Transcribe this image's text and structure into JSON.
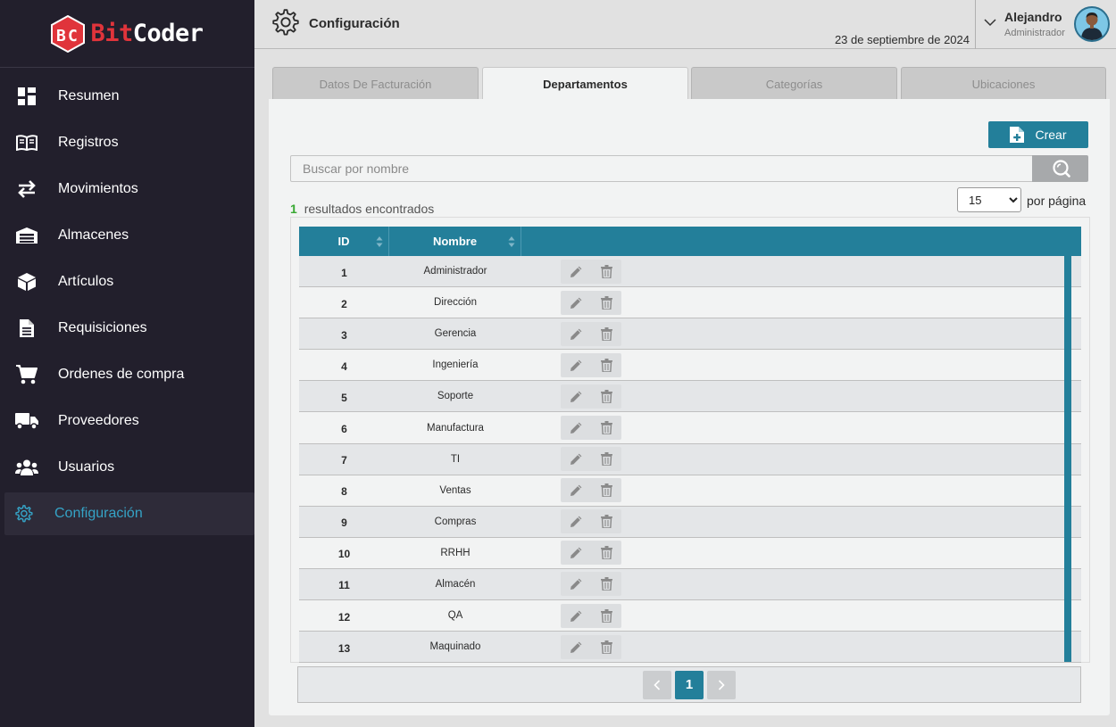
{
  "brand": {
    "part1": "Bit",
    "part2": "Coder",
    "accent": "#e0343b"
  },
  "sidebar": {
    "items": [
      {
        "label": "Resumen",
        "icon": "dashboard-icon"
      },
      {
        "label": "Registros",
        "icon": "book-icon"
      },
      {
        "label": "Movimientos",
        "icon": "arrows-exchange-icon"
      },
      {
        "label": "Almacenes",
        "icon": "warehouse-icon"
      },
      {
        "label": "Artículos",
        "icon": "box-icon"
      },
      {
        "label": "Requisiciones",
        "icon": "document-icon"
      },
      {
        "label": "Ordenes de compra",
        "icon": "cart-icon"
      },
      {
        "label": "Proveedores",
        "icon": "truck-icon"
      },
      {
        "label": "Usuarios",
        "icon": "users-icon"
      },
      {
        "label": "Configuración",
        "icon": "gear-icon",
        "active": true
      }
    ]
  },
  "header": {
    "title": "Configuración",
    "date": "23 de septiembre de 2024",
    "user_name": "Alejandro",
    "user_role": "Administrador"
  },
  "tabs": [
    {
      "label": "Datos De Facturación"
    },
    {
      "label": "Departamentos",
      "active": true
    },
    {
      "label": "Categorías"
    },
    {
      "label": "Ubicaciones"
    }
  ],
  "toolbar": {
    "create_label": "Crear"
  },
  "search": {
    "placeholder": "Buscar por nombre",
    "value": ""
  },
  "results": {
    "count": "1",
    "label": "resultados encontrados"
  },
  "per_page": {
    "selected": "15",
    "label": "por página"
  },
  "table": {
    "columns": [
      "ID",
      "Nombre"
    ],
    "rows": [
      {
        "id": "1",
        "name": "Administrador"
      },
      {
        "id": "2",
        "name": "Dirección"
      },
      {
        "id": "3",
        "name": "Gerencia"
      },
      {
        "id": "4",
        "name": "Ingeniería"
      },
      {
        "id": "5",
        "name": "Soporte"
      },
      {
        "id": "6",
        "name": "Manufactura"
      },
      {
        "id": "7",
        "name": "TI"
      },
      {
        "id": "8",
        "name": "Ventas"
      },
      {
        "id": "9",
        "name": "Compras"
      },
      {
        "id": "10",
        "name": "RRHH"
      },
      {
        "id": "11",
        "name": "Almacén"
      },
      {
        "id": "12",
        "name": "QA"
      },
      {
        "id": "13",
        "name": "Maquinado"
      }
    ]
  },
  "pagination": {
    "current": "1"
  },
  "colors": {
    "primary": "#237f9a",
    "sidebar_bg": "#221f2c",
    "active_nav": "#35a3c6",
    "count_green": "#38a832"
  }
}
